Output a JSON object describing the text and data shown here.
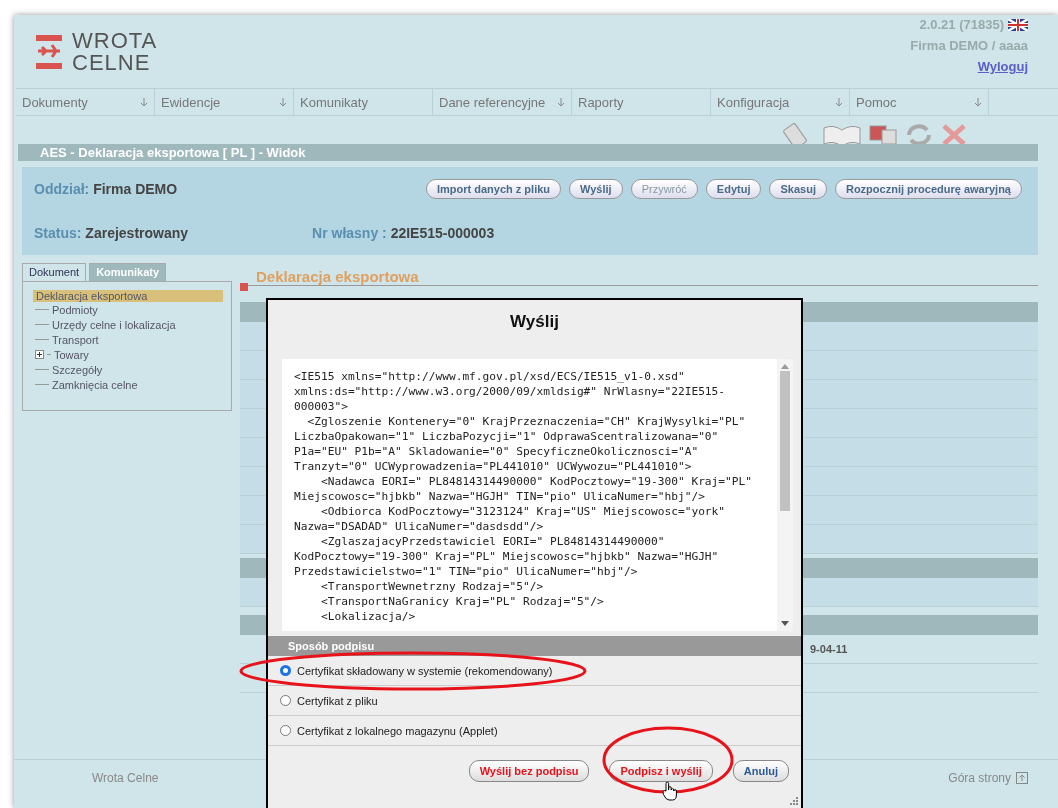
{
  "header": {
    "logo_line1": "WROTA",
    "logo_line2": "CELNE",
    "version": "2.0.21 (71835)",
    "user": "Firma DEMO / aaaa",
    "logout": "Wyloguj"
  },
  "menu": [
    {
      "label": "Dokumenty",
      "dropdown": true
    },
    {
      "label": "Ewidencje",
      "dropdown": true
    },
    {
      "label": "Komunikaty",
      "dropdown": false
    },
    {
      "label": "Dane referencyjne",
      "dropdown": true
    },
    {
      "label": "Raporty",
      "dropdown": false
    },
    {
      "label": "Konfiguracja",
      "dropdown": true
    },
    {
      "label": "Pomoc",
      "dropdown": true
    }
  ],
  "title_bar": "AES - Deklaracja eksportowa [ PL ]  -  Widok",
  "info": {
    "branch_label": "Oddział:",
    "branch": "Firma DEMO",
    "status_label": "Status:",
    "status": "Zarejestrowany",
    "own_no_label": "Nr własny :",
    "own_no": "22IE515-000003",
    "buttons": [
      {
        "label": "Import danych z pliku",
        "disabled": false
      },
      {
        "label": "Wyślij",
        "disabled": false
      },
      {
        "label": "Przywróć",
        "disabled": true
      },
      {
        "label": "Edytuj",
        "disabled": false
      },
      {
        "label": "Skasuj",
        "disabled": false
      },
      {
        "label": "Rozpocznij procedurę awaryjną",
        "disabled": false
      }
    ]
  },
  "side_tabs": [
    {
      "label": "Dokument",
      "selected": true
    },
    {
      "label": "Komunikaty",
      "selected": false
    }
  ],
  "tree": {
    "label": "Deklaracja eksportowa",
    "selected": true,
    "children": [
      {
        "label": "Podmioty",
        "expandable": false
      },
      {
        "label": "Urzędy celne i lokalizacja",
        "expandable": false
      },
      {
        "label": "Transport",
        "expandable": false
      },
      {
        "label": "Towary",
        "expandable": true
      },
      {
        "label": "Szczegóły",
        "expandable": false
      },
      {
        "label": "Zamknięcia celne",
        "expandable": false
      }
    ]
  },
  "content_heading": "Deklaracja eksportowa",
  "background_cell": "9-04-11",
  "footer": {
    "left": "Wrota Celne",
    "right": "Góra strony"
  },
  "dialog": {
    "title": "Wyślij",
    "xml_lines": [
      "<IE515 xmlns=\"http://www.mf.gov.pl/xsd/ECS/IE515_v1-0.xsd\"",
      "xmlns:ds=\"http://www.w3.org/2000/09/xmldsig#\" NrWlasny=\"22IE515-",
      "000003\">",
      "  <Zgloszenie Kontenery=\"0\" KrajPrzeznaczenia=\"CH\" KrajWysylki=\"PL\"",
      "LiczbaOpakowan=\"1\" LiczbaPozycji=\"1\" OdprawaScentralizowana=\"0\"",
      "P1a=\"EU\" P1b=\"A\" Skladowanie=\"0\" SpecyficzneOkolicznosci=\"A\"",
      "Tranzyt=\"0\" UCWyprowadzenia=\"PL441010\" UCWywozu=\"PL441010\">",
      "    <Nadawca EORI=\" PL84814314490000\" KodPocztowy=\"19-300\" Kraj=\"PL\"",
      "Miejscowosc=\"hjbkb\" Nazwa=\"HGJH\" TIN=\"pio\" UlicaNumer=\"hbj\"/>",
      "    <Odbiorca KodPocztowy=\"3123124\" Kraj=\"US\" Miejscowosc=\"york\"",
      "Nazwa=\"DSADAD\" UlicaNumer=\"dasdsdd\"/>",
      "    <ZglaszajacyPrzedstawiciel EORI=\" PL84814314490000\"",
      "KodPocztowy=\"19-300\" Kraj=\"PL\" Miejscowosc=\"hjbkb\" Nazwa=\"HGJH\"",
      "Przedstawicielstwo=\"1\" TIN=\"pio\" UlicaNumer=\"hbj\"/>",
      "    <TransportWewnetrzny Rodzaj=\"5\"/>",
      "    <TransportNaGranicy Kraj=\"PL\" Rodzaj=\"5\"/>",
      "    <Lokalizacja/>"
    ],
    "section": "Sposób podpisu",
    "options": [
      {
        "label": "Certyfikat składowany w systemie (rekomendowany)",
        "selected": true
      },
      {
        "label": "Certyfikat z pliku",
        "selected": false
      },
      {
        "label": "Certyfikat z lokalnego magazynu (Applet)",
        "selected": false
      }
    ],
    "buttons": [
      {
        "label": "Wyślij bez podpisu",
        "kind": "danger"
      },
      {
        "label": "Podpisz i wyślij",
        "kind": "danger"
      },
      {
        "label": "Anuluj",
        "kind": "normal"
      }
    ]
  }
}
